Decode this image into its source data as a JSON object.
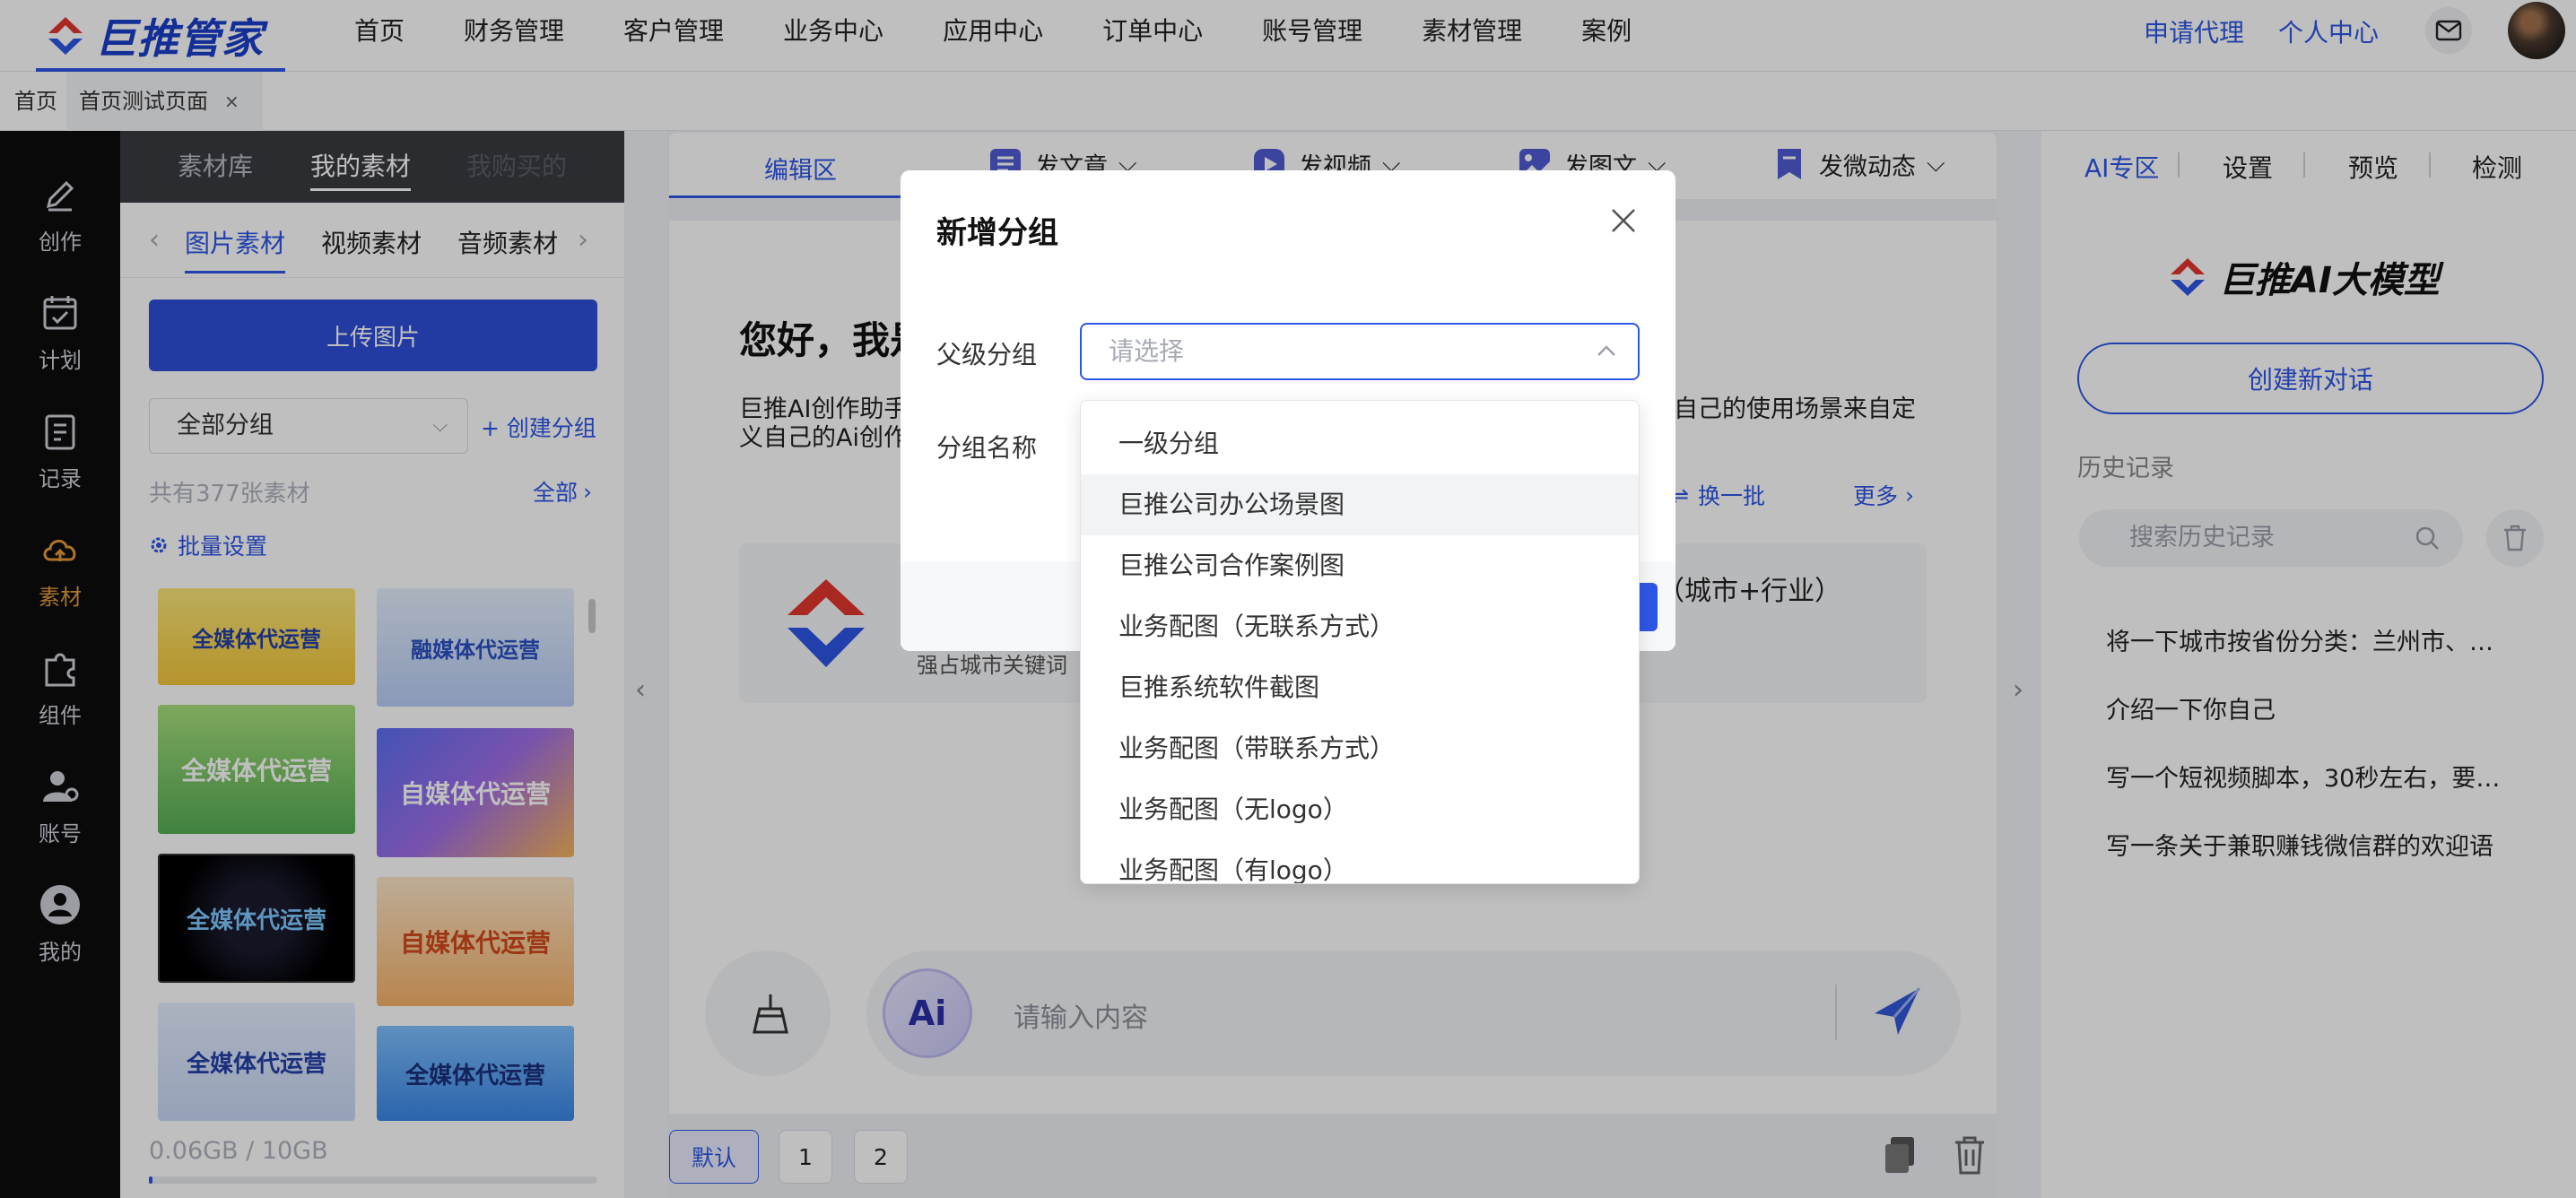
{
  "brand": {
    "name": "巨推管家",
    "accent": "#2e56e6",
    "logo_red": "#e2362d"
  },
  "nav": {
    "items": [
      "首页",
      "财务管理",
      "客户管理",
      "业务中心",
      "应用中心",
      "订单中心",
      "账号管理",
      "素材管理",
      "案例"
    ],
    "apply_agent": "申请代理",
    "personal_center": "个人中心",
    "mail_icon": "mail-icon"
  },
  "tabs": {
    "home": "首页",
    "current": "首页测试页面",
    "close": "×"
  },
  "sidebar": {
    "items": [
      {
        "label": "创作",
        "icon": "pen-icon"
      },
      {
        "label": "计划",
        "icon": "calendar-icon"
      },
      {
        "label": "记录",
        "icon": "clipboard-icon"
      },
      {
        "label": "素材",
        "icon": "cloud-upload-icon"
      },
      {
        "label": "组件",
        "icon": "puzzle-icon"
      },
      {
        "label": "账号",
        "icon": "user-settings-icon"
      },
      {
        "label": "我的",
        "icon": "profile-icon"
      }
    ]
  },
  "material": {
    "tabs": [
      "素材库",
      "我的素材",
      "我购买的"
    ],
    "sub_tabs": [
      "图片素材",
      "视频素材",
      "音频素材"
    ],
    "upload": "上传图片",
    "group_select": "全部分组",
    "create_group": "+ 创建分组",
    "total": "共有377张素材",
    "all": "全部",
    "batch": "批量设置",
    "thumbnails": [
      "全媒体代运营",
      "融媒体代运营",
      "全媒体代运营",
      "自媒体代运营",
      "全媒体代运营",
      "自媒体代运营",
      "全媒体代运营",
      "全媒体代运营"
    ],
    "storage": "0.06GB / 10GB",
    "storage_used": 0.006
  },
  "editor": {
    "tabs": [
      "编辑区",
      "发文章",
      "发视频",
      "发图文",
      "发微动态"
    ],
    "hello": "您好，我是",
    "desc_left": "巨推AI创作助手",
    "desc_left2": "义自己的Ai创作",
    "desc_right": "自己的使用场景来自定",
    "refresh": "换一批",
    "more": "更多",
    "card_title": "（城市+行业）",
    "card_sub": "强占城市关键词",
    "chat_placeholder": "请输入内容",
    "ai_badge": "Ai",
    "pager": [
      "默认",
      "1",
      "2"
    ]
  },
  "ai_panel": {
    "tabs": [
      "AI专区",
      "设置",
      "预览",
      "检测"
    ],
    "logo": "巨推AI大模型",
    "new_chat": "创建新对话",
    "history_title": "历史记录",
    "search_placeholder": "搜索历史记录",
    "history": [
      "将一下城市按省份分类：兰州市、…",
      "介绍一下你自己",
      "写一个短视频脚本，30秒左右，要…",
      "写一条关于兼职赚钱微信群的欢迎语"
    ]
  },
  "modal": {
    "title": "新增分组",
    "parent_label": "父级分组",
    "parent_placeholder": "请选择",
    "name_label": "分组名称",
    "options": [
      "一级分组",
      "巨推公司办公场景图",
      "巨推公司合作案例图",
      "业务配图（无联系方式）",
      "巨推系统软件截图",
      "业务配图（带联系方式）",
      "业务配图（无logo）",
      "业务配图（有logo）"
    ],
    "highlighted_index": 1
  }
}
